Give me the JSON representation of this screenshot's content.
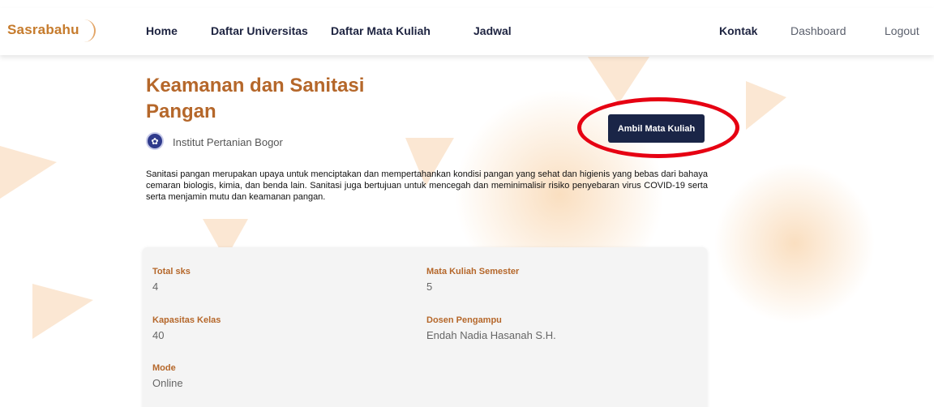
{
  "navbar": {
    "logo": "Sasrabahu",
    "links": [
      "Home",
      "Daftar Universitas",
      "Daftar Mata Kuliah",
      "Jadwal"
    ],
    "right_links": [
      "Kontak",
      "Dashboard",
      "Logout"
    ]
  },
  "course": {
    "title": "Keamanan dan Sanitasi Pangan",
    "university": "Institut Pertanian Bogor",
    "take_button": "Ambil Mata Kuliah",
    "description": "Sanitasi pangan merupakan upaya untuk menciptakan dan mempertahankan kondisi pangan yang sehat dan higienis yang bebas dari bahaya cemaran biologis, kimia, dan benda lain. Sanitasi juga bertujuan untuk mencegah dan meminimalisir risiko penyebaran virus COVID-19 serta serta menjamin mutu dan keamanan pangan."
  },
  "details": {
    "total_sks": {
      "label": "Total sks",
      "value": "4"
    },
    "semester": {
      "label": "Mata Kuliah Semester",
      "value": "5"
    },
    "kapasitas": {
      "label": "Kapasitas Kelas",
      "value": "40"
    },
    "dosen": {
      "label": "Dosen Pengampu",
      "value": "Endah Nadia Hasanah S.H."
    },
    "mode": {
      "label": "Mode",
      "value": "Online"
    }
  },
  "colors": {
    "accent": "#b5672a",
    "button": "#1a2547",
    "highlight": "#e60012"
  },
  "icons": [
    "university-logo-icon"
  ]
}
